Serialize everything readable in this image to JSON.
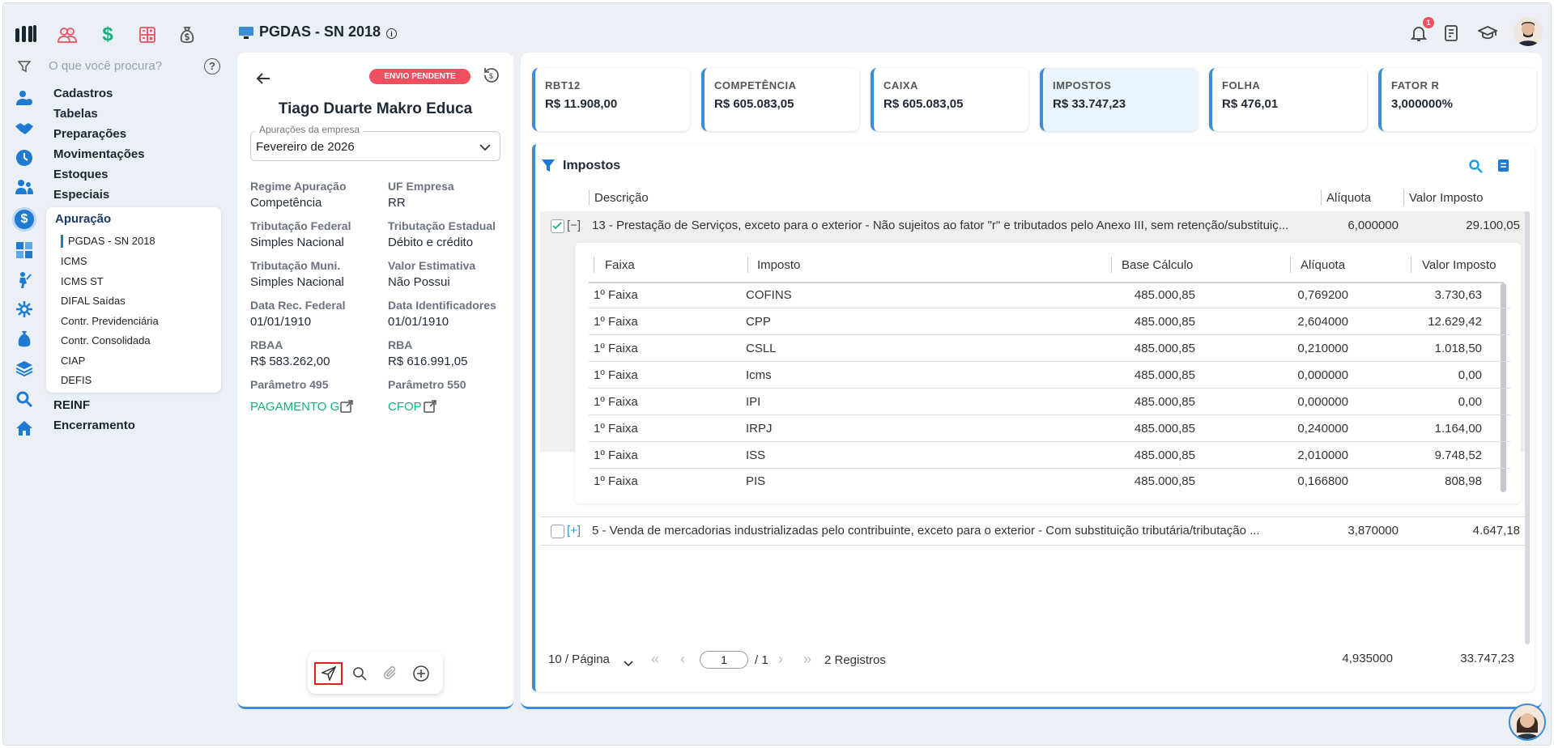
{
  "app": {
    "title": "PGDAS - SN 2018",
    "notification_count": "1"
  },
  "colors": {
    "accent": "#3c8dd6",
    "pending": "#ef4f5f",
    "green": "#16b07a",
    "primary_dark": "#1a2733"
  },
  "sidebar": {
    "search_placeholder": "O que você procura?",
    "menu": [
      "Cadastros",
      "Tabelas",
      "Preparações",
      "Movimentações",
      "Estoques",
      "Especiais"
    ],
    "apuracao": {
      "label": "Apuração",
      "items": [
        "PGDAS - SN 2018",
        "ICMS",
        "ICMS ST",
        "DIFAL Saídas",
        "Contr. Previdenciária",
        "Contr. Consolidada",
        "CIAP",
        "DEFIS"
      ]
    },
    "bottom_menu": [
      "REINF",
      "Encerramento"
    ]
  },
  "company": {
    "status_badge": "ENVIO PENDENTE",
    "name": "Tiago Duarte Makro Educa",
    "select_label": "Apurações da empresa",
    "select_value": "Fevereiro de 2026",
    "fields": [
      {
        "label": "Regime Apuração",
        "value": "Competência"
      },
      {
        "label": "UF Empresa",
        "value": "RR"
      },
      {
        "label": "Tributação Federal",
        "value": "Simples Nacional"
      },
      {
        "label": "Tributação Estadual",
        "value": "Débito e crédito"
      },
      {
        "label": "Tributação Muni.",
        "value": "Simples Nacional"
      },
      {
        "label": "Valor Estimativa",
        "value": "Não Possui"
      },
      {
        "label": "Data Rec. Federal",
        "value": "01/01/1910"
      },
      {
        "label": "Data Identificadores",
        "value": "01/01/1910"
      },
      {
        "label": "RBAA",
        "value": "R$ 583.262,00"
      },
      {
        "label": "RBA",
        "value": "R$ 616.991,05"
      },
      {
        "label": "Parâmetro 495",
        "value": "PAGAMENTO G."
      },
      {
        "label": "Parâmetro 550",
        "value": "CFOP"
      }
    ]
  },
  "summary_cards": [
    {
      "title": "RBT12",
      "value": "R$ 11.908,00"
    },
    {
      "title": "COMPETÊNCIA",
      "value": "R$ 605.083,05"
    },
    {
      "title": "CAIXA",
      "value": "R$ 605.083,05"
    },
    {
      "title": "IMPOSTOS",
      "value": "R$ 33.747,23"
    },
    {
      "title": "FOLHA",
      "value": "R$ 476,01"
    },
    {
      "title": "FATOR R",
      "value": "3,000000%"
    }
  ],
  "taxes": {
    "title": "Impostos",
    "headers": {
      "descricao": "Descrição",
      "aliquota": "Alíquota",
      "valor": "Valor Imposto"
    },
    "rows": [
      {
        "toggle": "[−]",
        "descricao": "13 - Prestação de Serviços, exceto para o exterior - Não sujeitos ao fator \"r\" e tributados pelo Anexo III, sem retenção/substituiç...",
        "aliquota": "6,000000",
        "valor": "29.100,05"
      },
      {
        "toggle": "[+]",
        "descricao": "5 - Venda de mercadorias industrializadas pelo contribuinte, exceto para o exterior - Com substituição tributária/tributação ...",
        "aliquota": "3,870000",
        "valor": "4.647,18"
      }
    ],
    "sub_headers": {
      "faixa": "Faixa",
      "imposto": "Imposto",
      "base": "Base Cálculo",
      "aliquota": "Alíquota",
      "valor": "Valor Imposto"
    },
    "sub_rows": [
      {
        "faixa": "1º Faixa",
        "imposto": "COFINS",
        "base": "485.000,85",
        "aliquota": "0,769200",
        "valor": "3.730,63"
      },
      {
        "faixa": "1º Faixa",
        "imposto": "CPP",
        "base": "485.000,85",
        "aliquota": "2,604000",
        "valor": "12.629,42"
      },
      {
        "faixa": "1º Faixa",
        "imposto": "CSLL",
        "base": "485.000,85",
        "aliquota": "0,210000",
        "valor": "1.018,50"
      },
      {
        "faixa": "1º Faixa",
        "imposto": "Icms",
        "base": "485.000,85",
        "aliquota": "0,000000",
        "valor": "0,00"
      },
      {
        "faixa": "1º Faixa",
        "imposto": "IPI",
        "base": "485.000,85",
        "aliquota": "0,000000",
        "valor": "0,00"
      },
      {
        "faixa": "1º Faixa",
        "imposto": "IRPJ",
        "base": "485.000,85",
        "aliquota": "0,240000",
        "valor": "1.164,00"
      },
      {
        "faixa": "1º Faixa",
        "imposto": "ISS",
        "base": "485.000,85",
        "aliquota": "2,010000",
        "valor": "9.748,52"
      },
      {
        "faixa": "1º Faixa",
        "imposto": "PIS",
        "base": "485.000,85",
        "aliquota": "0,166800",
        "valor": "808,98"
      }
    ],
    "pagination": {
      "per_page": "10 / Página",
      "first": "«",
      "prev": "‹",
      "page": "1",
      "total_pages": "/ 1",
      "next": "›",
      "last": "»",
      "records": "2 Registros"
    },
    "totals": {
      "aliquota": "4,935000",
      "valor": "33.747,23"
    }
  }
}
